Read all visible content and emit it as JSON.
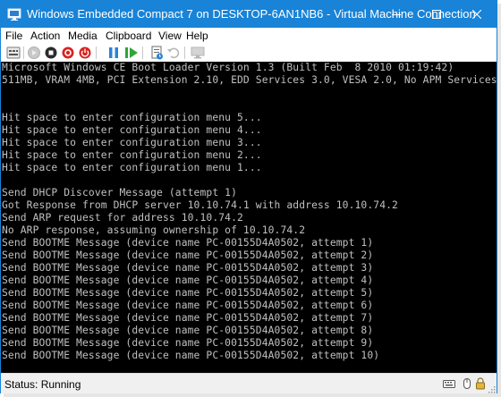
{
  "window": {
    "title": "Windows Embedded Compact 7 on DESKTOP-6AN1NB6 - Virtual Machine Connection",
    "accent": "#1883d7"
  },
  "titlebar_buttons": [
    {
      "name": "minimize-button",
      "icon": "minimize-icon"
    },
    {
      "name": "maximize-button",
      "icon": "maximize-icon"
    },
    {
      "name": "close-button",
      "icon": "close-icon"
    }
  ],
  "menu": [
    "File",
    "Action",
    "Media",
    "Clipboard",
    "View",
    "Help"
  ],
  "toolbar": [
    {
      "name": "ctrl-alt-del-button",
      "icon": "ctrl-alt-del-icon",
      "enabled": true
    },
    {
      "name": "start-button",
      "icon": "start-icon",
      "enabled": false
    },
    {
      "name": "turn-off-button",
      "icon": "turn-off-icon",
      "enabled": true
    },
    {
      "name": "shut-down-button",
      "icon": "shut-down-icon",
      "enabled": true
    },
    {
      "name": "power-button",
      "icon": "power-icon",
      "enabled": true
    },
    {
      "name": "pause-button",
      "icon": "pause-icon",
      "enabled": true
    },
    {
      "name": "resume-button",
      "icon": "resume-icon",
      "enabled": true
    },
    {
      "name": "checkpoint-button",
      "icon": "checkpoint-icon",
      "enabled": true
    },
    {
      "name": "revert-button",
      "icon": "revert-icon",
      "enabled": false
    },
    {
      "name": "enhanced-session-button",
      "icon": "enhanced-session-icon",
      "enabled": false
    }
  ],
  "console": {
    "background": "#000000",
    "foreground": "#c0c0c0",
    "lines": [
      "Microsoft Windows CE Boot Loader Version 1.3 (Built Feb  8 2010 01:19:42)",
      "511MB, VRAM 4MB, PCI Extension 2.10, EDD Services 3.0, VESA 2.0, No APM Services",
      "",
      "",
      "Hit space to enter configuration menu 5...",
      "Hit space to enter configuration menu 4...",
      "Hit space to enter configuration menu 3...",
      "Hit space to enter configuration menu 2...",
      "Hit space to enter configuration menu 1...",
      "",
      "Send DHCP Discover Message (attempt 1)",
      "Got Response from DHCP server 10.10.74.1 with address 10.10.74.2",
      "Send ARP request for address 10.10.74.2",
      "No ARP response, assuming ownership of 10.10.74.2",
      "Send BOOTME Message (device name PC-00155D4A0502, attempt 1)",
      "Send BOOTME Message (device name PC-00155D4A0502, attempt 2)",
      "Send BOOTME Message (device name PC-00155D4A0502, attempt 3)",
      "Send BOOTME Message (device name PC-00155D4A0502, attempt 4)",
      "Send BOOTME Message (device name PC-00155D4A0502, attempt 5)",
      "Send BOOTME Message (device name PC-00155D4A0502, attempt 6)",
      "Send BOOTME Message (device name PC-00155D4A0502, attempt 7)",
      "Send BOOTME Message (device name PC-00155D4A0502, attempt 8)",
      "Send BOOTME Message (device name PC-00155D4A0502, attempt 9)",
      "Send BOOTME Message (device name PC-00155D4A0502, attempt 10)"
    ]
  },
  "status": {
    "text": "Status: Running",
    "icons": [
      "keyboard-icon",
      "mouse-icon",
      "lock-icon"
    ]
  }
}
